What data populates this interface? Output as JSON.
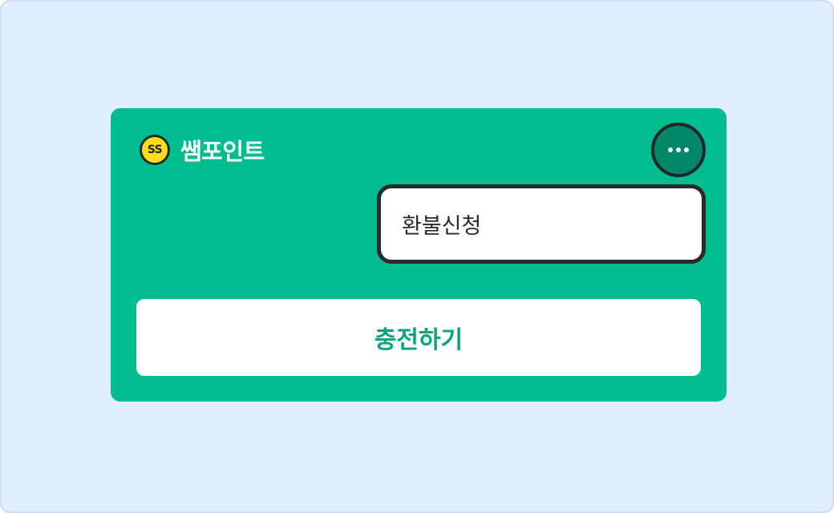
{
  "brand": {
    "coin_label": "SS",
    "title": "쌤포인트",
    "coin_color": "#ffdc18"
  },
  "menu": {
    "button_icon": "more-dots-icon",
    "items": [
      {
        "label": "환불신청"
      }
    ]
  },
  "actions": {
    "charge_label": "충전하기"
  },
  "colors": {
    "background": "#e0efff",
    "card": "#00bc8f",
    "more_button": "#00876a",
    "charge_text": "#0aa57d"
  }
}
